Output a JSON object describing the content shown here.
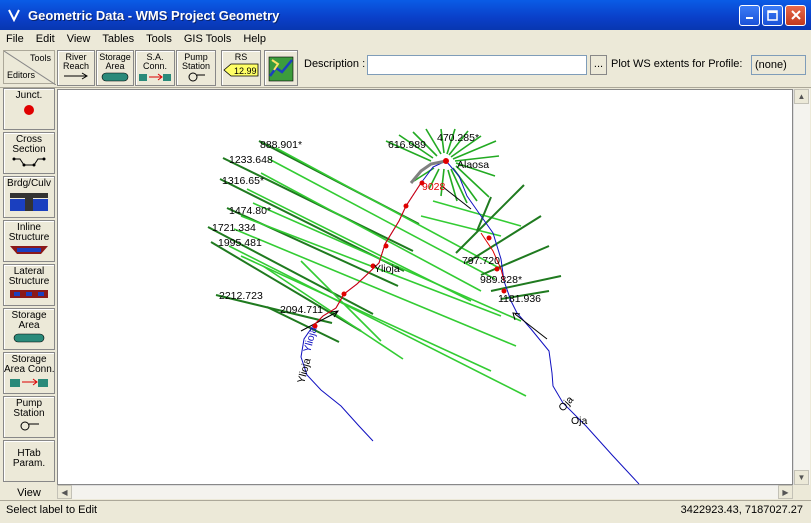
{
  "window": {
    "title": "Geometric Data - WMS Project Geometry"
  },
  "menu": [
    "File",
    "Edit",
    "View",
    "Tables",
    "Tools",
    "GIS Tools",
    "Help"
  ],
  "toolbar": {
    "tools_label": "Tools",
    "editors_label": "Editors",
    "river_reach": "River\nReach",
    "storage_area": "Storage\nArea",
    "sa_conn": "S.A.\nConn.",
    "pump_station": "Pump\nStation",
    "rs_label": "RS",
    "rs_value": "12.99",
    "description_label": "Description :",
    "description_value": "",
    "dots_label": "...",
    "plot_ws_label": "Plot WS extents for Profile:",
    "profile_value": "(none)"
  },
  "editors": {
    "junct": "Junct.",
    "cross_section": "Cross\nSection",
    "brdg_culv": "Brdg/Culv",
    "inline_structure": "Inline\nStructure",
    "lateral_structure": "Lateral\nStructure",
    "storage_area": "Storage\nArea",
    "storage_area_conn": "Storage\nArea Conn.",
    "pump_station": "Pump\nStation",
    "htab_param": "HTab\nParam.",
    "view_label": "View"
  },
  "map": {
    "cross_section_labels": [
      "888.901*",
      "1233.648",
      "1316.65*",
      "1474.80*",
      "1721.334",
      "1995.481",
      "2212.723",
      "2094.711",
      "616.989",
      "470.285*",
      "797.720",
      "989.828*",
      "1181.936"
    ],
    "highlight_label": "9028",
    "junction_labels": [
      "Alaosa",
      "Ylioja"
    ],
    "river_labels": [
      "Ylioja",
      "Oja"
    ],
    "reach_labels": [
      "Ylioja",
      "Oja"
    ]
  },
  "status": {
    "left": "Select label to Edit",
    "right": "3422923.43, 7187027.27"
  },
  "colors": {
    "xs_dark": "#1a7a1a",
    "xs_light": "#2fd22f",
    "reach": "#0000c0",
    "junction": "#d00000"
  }
}
